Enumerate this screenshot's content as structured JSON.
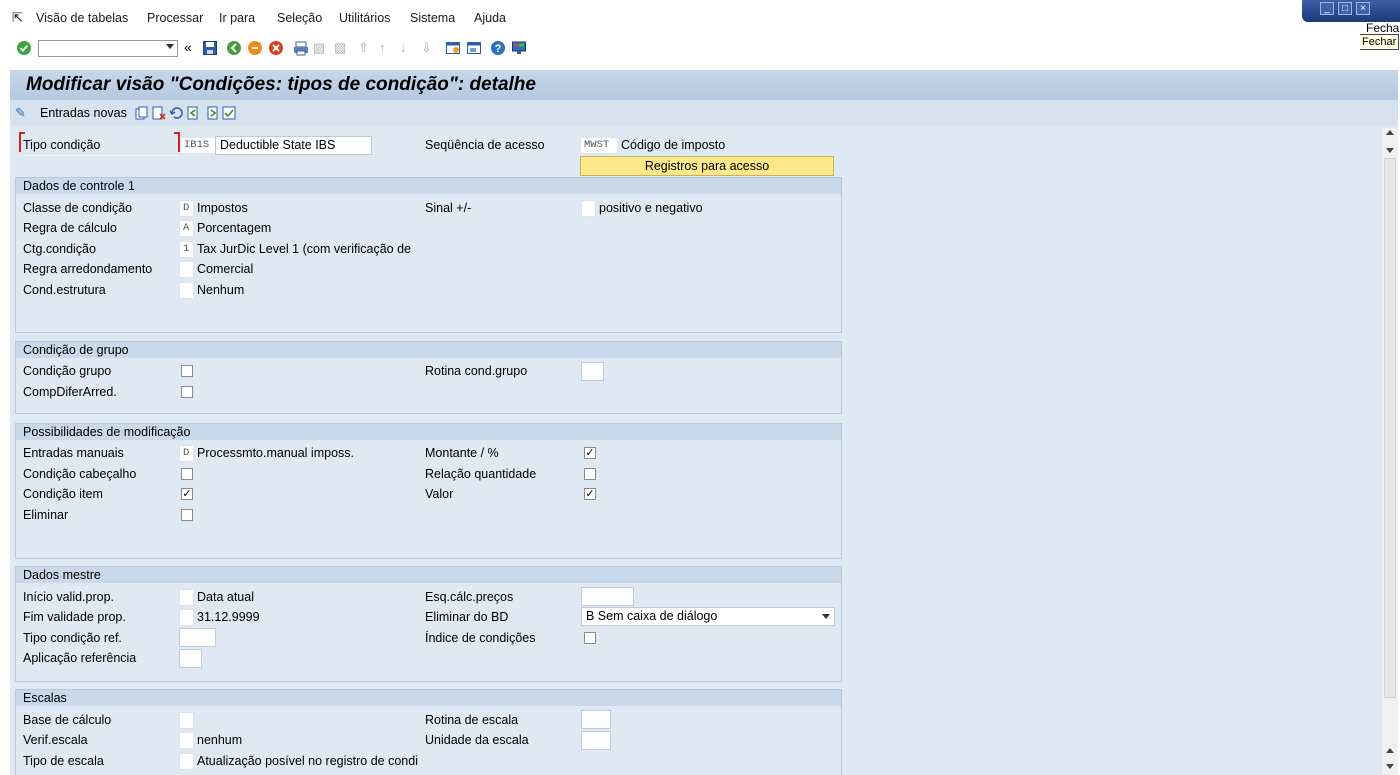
{
  "menu": {
    "items": [
      "Visão de tabelas",
      "Processar",
      "Ir para",
      "Seleção",
      "Utilitários",
      "Sistema",
      "Ajuda"
    ],
    "close_label_clip": "Fecha",
    "close_tooltip": "Fechar"
  },
  "page": {
    "title": "Modificar visão \"Condições: tipos de condição\": detalhe",
    "new_entries": "Entradas novas"
  },
  "header": {
    "tipo_label": "Tipo condição",
    "tipo_code": "IB1S",
    "tipo_desc": "Deductible State IBS",
    "seq_label": "Seqüência de acesso",
    "seq_code": "MWST",
    "seq_desc": "Código de imposto",
    "reg_button": "Registros para acesso"
  },
  "g1": {
    "title": "Dados de controle 1",
    "classe_label": "Classe de condição",
    "classe_code": "D",
    "classe_desc": "Impostos",
    "regra_label": "Regra de cálculo",
    "regra_code": "A",
    "regra_desc": "Porcentagem",
    "ctg_label": "Ctg.condição",
    "ctg_code": "1",
    "ctg_desc": "Tax JurDic Level 1 (com verificação de",
    "arred_label": "Regra arredondamento",
    "arred_desc": "Comercial",
    "estr_label": "Cond.estrutura",
    "estr_desc": "Nenhum",
    "sinal_label": "Sinal +/-",
    "sinal_desc": "positivo e negativo"
  },
  "g2": {
    "title": "Condição de grupo",
    "grupo_label": "Condição grupo",
    "comp_label": "CompDiferArred.",
    "rotina_label": "Rotina cond.grupo"
  },
  "g3": {
    "title": "Possibilidades de modificação",
    "manual_label": "Entradas manuais",
    "manual_code": "D",
    "manual_desc": "Processmto.manual imposs.",
    "cab_label": "Condição cabeçalho",
    "item_label": "Condição item",
    "elim_label": "Eliminar",
    "mont_label": "Montante / %",
    "relq_label": "Relação quantidade",
    "valor_label": "Valor"
  },
  "g4": {
    "title": "Dados mestre",
    "inicio_label": "Início valid.prop.",
    "inicio_desc": "Data atual",
    "fim_label": "Fim validade prop.",
    "fim_desc": "31.12.9999",
    "tref_label": "Tipo condição ref.",
    "apl_label": "Aplicação referência",
    "esq_label": "Esq.cálc.preços",
    "elimbd_label": "Eliminar do BD",
    "elimbd_value": "B Sem caixa de diálogo",
    "indice_label": "Índice de condições"
  },
  "g5": {
    "title": "Escalas",
    "base_label": "Base de cálculo",
    "verif_label": "Verif.escala",
    "verif_desc": "nenhum",
    "tipo_label": "Tipo de escala",
    "tipo_desc": "Atualização posível no registro de condi",
    "rotina_label": "Rotina de escala",
    "unid_label": "Unidade da escala"
  },
  "checks": {
    "grupo": "",
    "comp": "",
    "cab": "",
    "item": "✓",
    "elim": "",
    "mont": "✓",
    "relq": "",
    "valor": "✓",
    "indice": ""
  },
  "colors": {
    "area_bg": "#dfe9f3",
    "group_header": "#c9d9ea",
    "title_bar": "#b6c9df",
    "button_yellow": "#fde98a"
  }
}
